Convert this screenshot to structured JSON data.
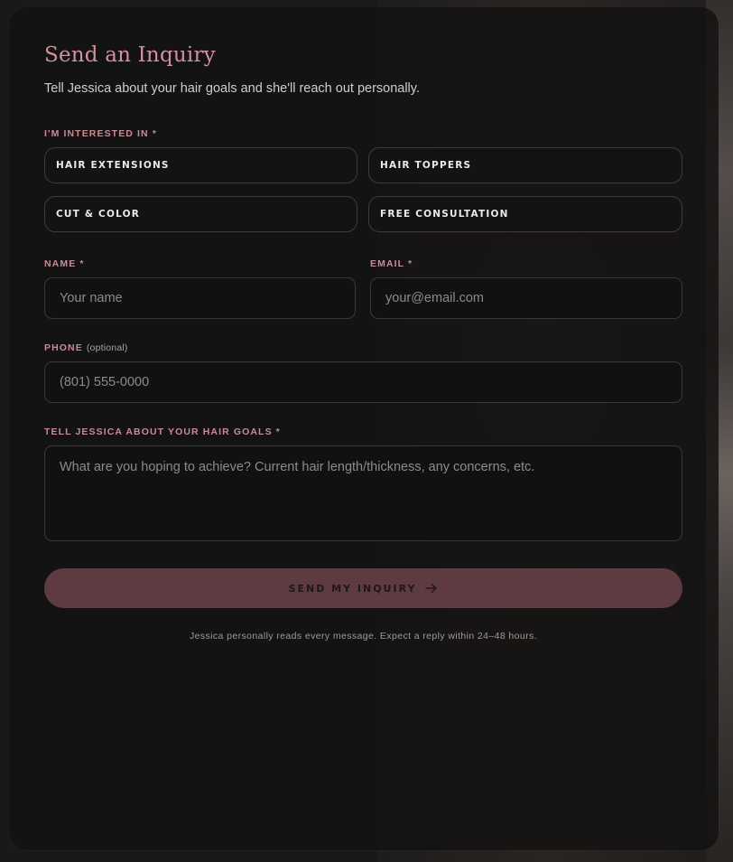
{
  "form": {
    "title": "Send an Inquiry",
    "subtitle": "Tell Jessica about your hair goals and she'll reach out personally.",
    "interest_label": "I'M INTERESTED IN *",
    "interests": [
      "HAIR EXTENSIONS",
      "HAIR TOPPERS",
      "CUT & COLOR",
      "FREE CONSULTATION"
    ],
    "name": {
      "label": "NAME *",
      "placeholder": "Your name",
      "value": ""
    },
    "email": {
      "label": "EMAIL *",
      "placeholder": "your@email.com",
      "value": ""
    },
    "phone": {
      "label": "PHONE",
      "optional": "(optional)",
      "placeholder": "(801) 555-0000",
      "value": ""
    },
    "goals": {
      "label": "TELL JESSICA ABOUT YOUR HAIR GOALS *",
      "placeholder": "What are you hoping to achieve? Current hair length/thickness, any concerns, etc.",
      "value": ""
    },
    "submit_label": "SEND MY INQUIRY",
    "submit_icon": "arrow-right-icon",
    "footnote": "Jessica personally reads every message. Expect a reply within 24–48 hours."
  },
  "colors": {
    "accent": "#d4909c",
    "label": "#c98a95",
    "button_bg": "#5e3b40",
    "card_bg": "#141313"
  }
}
